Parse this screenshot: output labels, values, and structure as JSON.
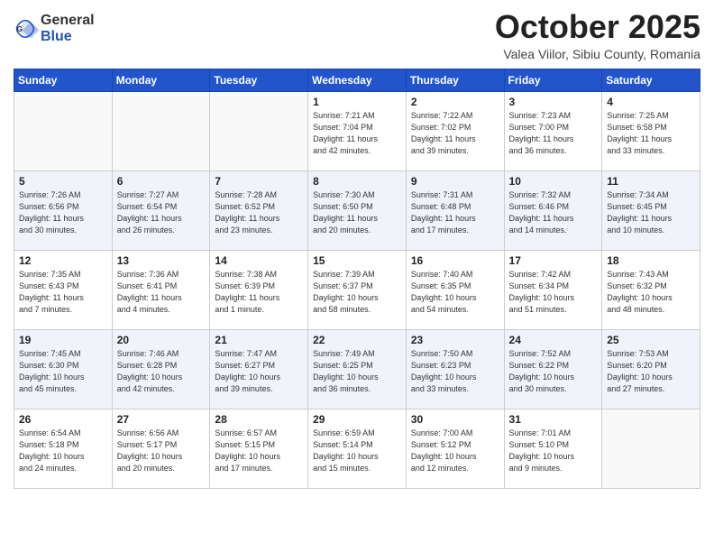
{
  "header": {
    "logo_general": "General",
    "logo_blue": "Blue",
    "month_title": "October 2025",
    "subtitle": "Valea Viilor, Sibiu County, Romania"
  },
  "days_of_week": [
    "Sunday",
    "Monday",
    "Tuesday",
    "Wednesday",
    "Thursday",
    "Friday",
    "Saturday"
  ],
  "weeks": [
    [
      {
        "day": "",
        "info": ""
      },
      {
        "day": "",
        "info": ""
      },
      {
        "day": "",
        "info": ""
      },
      {
        "day": "1",
        "info": "Sunrise: 7:21 AM\nSunset: 7:04 PM\nDaylight: 11 hours\nand 42 minutes."
      },
      {
        "day": "2",
        "info": "Sunrise: 7:22 AM\nSunset: 7:02 PM\nDaylight: 11 hours\nand 39 minutes."
      },
      {
        "day": "3",
        "info": "Sunrise: 7:23 AM\nSunset: 7:00 PM\nDaylight: 11 hours\nand 36 minutes."
      },
      {
        "day": "4",
        "info": "Sunrise: 7:25 AM\nSunset: 6:58 PM\nDaylight: 11 hours\nand 33 minutes."
      }
    ],
    [
      {
        "day": "5",
        "info": "Sunrise: 7:26 AM\nSunset: 6:56 PM\nDaylight: 11 hours\nand 30 minutes."
      },
      {
        "day": "6",
        "info": "Sunrise: 7:27 AM\nSunset: 6:54 PM\nDaylight: 11 hours\nand 26 minutes."
      },
      {
        "day": "7",
        "info": "Sunrise: 7:28 AM\nSunset: 6:52 PM\nDaylight: 11 hours\nand 23 minutes."
      },
      {
        "day": "8",
        "info": "Sunrise: 7:30 AM\nSunset: 6:50 PM\nDaylight: 11 hours\nand 20 minutes."
      },
      {
        "day": "9",
        "info": "Sunrise: 7:31 AM\nSunset: 6:48 PM\nDaylight: 11 hours\nand 17 minutes."
      },
      {
        "day": "10",
        "info": "Sunrise: 7:32 AM\nSunset: 6:46 PM\nDaylight: 11 hours\nand 14 minutes."
      },
      {
        "day": "11",
        "info": "Sunrise: 7:34 AM\nSunset: 6:45 PM\nDaylight: 11 hours\nand 10 minutes."
      }
    ],
    [
      {
        "day": "12",
        "info": "Sunrise: 7:35 AM\nSunset: 6:43 PM\nDaylight: 11 hours\nand 7 minutes."
      },
      {
        "day": "13",
        "info": "Sunrise: 7:36 AM\nSunset: 6:41 PM\nDaylight: 11 hours\nand 4 minutes."
      },
      {
        "day": "14",
        "info": "Sunrise: 7:38 AM\nSunset: 6:39 PM\nDaylight: 11 hours\nand 1 minute."
      },
      {
        "day": "15",
        "info": "Sunrise: 7:39 AM\nSunset: 6:37 PM\nDaylight: 10 hours\nand 58 minutes."
      },
      {
        "day": "16",
        "info": "Sunrise: 7:40 AM\nSunset: 6:35 PM\nDaylight: 10 hours\nand 54 minutes."
      },
      {
        "day": "17",
        "info": "Sunrise: 7:42 AM\nSunset: 6:34 PM\nDaylight: 10 hours\nand 51 minutes."
      },
      {
        "day": "18",
        "info": "Sunrise: 7:43 AM\nSunset: 6:32 PM\nDaylight: 10 hours\nand 48 minutes."
      }
    ],
    [
      {
        "day": "19",
        "info": "Sunrise: 7:45 AM\nSunset: 6:30 PM\nDaylight: 10 hours\nand 45 minutes."
      },
      {
        "day": "20",
        "info": "Sunrise: 7:46 AM\nSunset: 6:28 PM\nDaylight: 10 hours\nand 42 minutes."
      },
      {
        "day": "21",
        "info": "Sunrise: 7:47 AM\nSunset: 6:27 PM\nDaylight: 10 hours\nand 39 minutes."
      },
      {
        "day": "22",
        "info": "Sunrise: 7:49 AM\nSunset: 6:25 PM\nDaylight: 10 hours\nand 36 minutes."
      },
      {
        "day": "23",
        "info": "Sunrise: 7:50 AM\nSunset: 6:23 PM\nDaylight: 10 hours\nand 33 minutes."
      },
      {
        "day": "24",
        "info": "Sunrise: 7:52 AM\nSunset: 6:22 PM\nDaylight: 10 hours\nand 30 minutes."
      },
      {
        "day": "25",
        "info": "Sunrise: 7:53 AM\nSunset: 6:20 PM\nDaylight: 10 hours\nand 27 minutes."
      }
    ],
    [
      {
        "day": "26",
        "info": "Sunrise: 6:54 AM\nSunset: 5:18 PM\nDaylight: 10 hours\nand 24 minutes."
      },
      {
        "day": "27",
        "info": "Sunrise: 6:56 AM\nSunset: 5:17 PM\nDaylight: 10 hours\nand 20 minutes."
      },
      {
        "day": "28",
        "info": "Sunrise: 6:57 AM\nSunset: 5:15 PM\nDaylight: 10 hours\nand 17 minutes."
      },
      {
        "day": "29",
        "info": "Sunrise: 6:59 AM\nSunset: 5:14 PM\nDaylight: 10 hours\nand 15 minutes."
      },
      {
        "day": "30",
        "info": "Sunrise: 7:00 AM\nSunset: 5:12 PM\nDaylight: 10 hours\nand 12 minutes."
      },
      {
        "day": "31",
        "info": "Sunrise: 7:01 AM\nSunset: 5:10 PM\nDaylight: 10 hours\nand 9 minutes."
      },
      {
        "day": "",
        "info": ""
      }
    ]
  ]
}
